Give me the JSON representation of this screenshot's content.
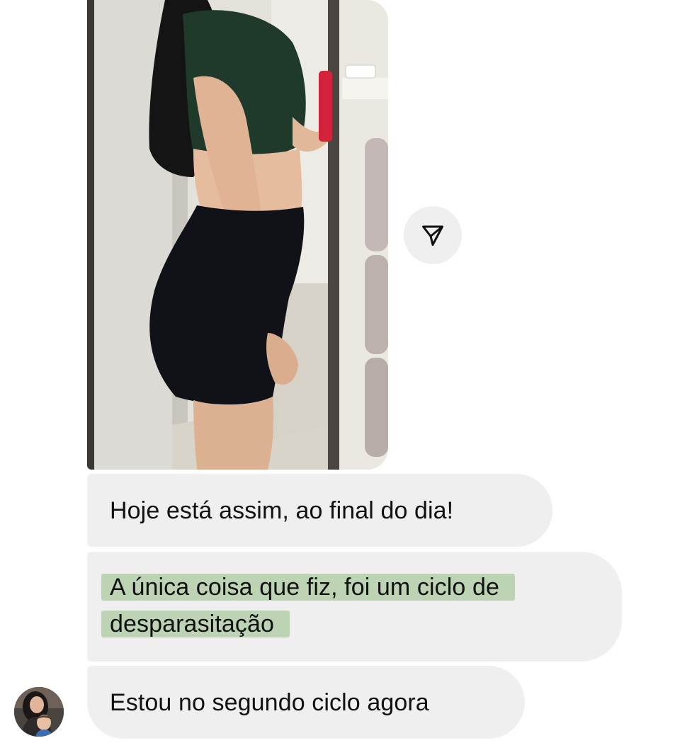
{
  "messages": [
    {
      "type": "photo",
      "content": "mirror-selfie-photo"
    },
    {
      "type": "text",
      "text": "Hoje está assim, ao final do dia!"
    },
    {
      "type": "text",
      "highlighted": true,
      "lines": [
        "A única coisa que fiz, foi um ciclo de",
        "desparasitação"
      ]
    },
    {
      "type": "text",
      "text": "Estou no segundo ciclo agora"
    }
  ],
  "share_button": {
    "icon": "paper-plane-icon"
  },
  "sender": {
    "avatar": "profile-avatar"
  },
  "colors": {
    "bubble_background": "#efefef",
    "highlight": "#bcd4b4",
    "text": "#111111",
    "share_button_background": "#efefef"
  }
}
